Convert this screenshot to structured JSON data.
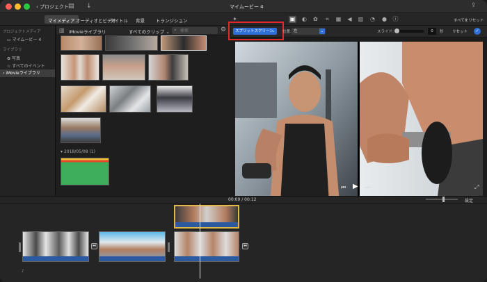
{
  "titlebar": {
    "back_label": "プロジェクト",
    "title": "マイムービー 4"
  },
  "tabs": [
    {
      "label": "マイメディア",
      "selected": true
    },
    {
      "label": "オーディオとビデオ",
      "selected": false
    },
    {
      "label": "タイトル",
      "selected": false
    },
    {
      "label": "背景",
      "selected": false
    },
    {
      "label": "トランジション",
      "selected": false
    }
  ],
  "toolbar_right": {
    "reset_all_label": "すべてをリセット"
  },
  "sidebar": {
    "project_media_header": "プロジェクトメディア",
    "project_item": "マイムービー 4",
    "library_header": "ライブラリ",
    "items": [
      "写真",
      "すべてのイベント",
      "iMovieライブラリ"
    ]
  },
  "browser": {
    "library_label": "iMovieライブラリ",
    "filter_label": "すべてのクリップ",
    "search_placeholder": "検索",
    "date_group": "2018/05/08",
    "date_count": "(1)"
  },
  "viewer": {
    "style_select": "スプリットスクリーン",
    "position_label": "位置:",
    "position_value": "左",
    "slide_label": "スライド:",
    "slide_value": "0",
    "slide_unit": "秒",
    "reset_label": "リセット"
  },
  "timeline": {
    "current_time": "00:09",
    "separator": "/",
    "total_time": "00:12",
    "settings_label": "設定"
  },
  "colors": {
    "highlight_box": "#e02828",
    "clip_bar": "#2c5aa0",
    "accent": "#2f6fd6"
  }
}
